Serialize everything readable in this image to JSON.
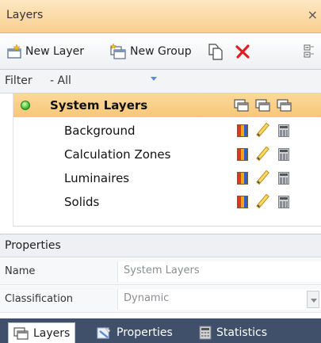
{
  "panel": {
    "title": "Layers",
    "close_glyph": "×"
  },
  "toolbar": {
    "new_layer_label": "New Layer",
    "new_group_label": "New Group",
    "icons": [
      "new-layer-icon",
      "new-group-icon",
      "copy-icon",
      "delete-icon",
      "expand-collapse-icon"
    ]
  },
  "filter": {
    "label": "Filter",
    "value": "- All"
  },
  "tree": {
    "group": {
      "label": "System Layers",
      "status": "active"
    },
    "items": [
      {
        "label": "Background"
      },
      {
        "label": "Calculation Zones"
      },
      {
        "label": "Luminaires"
      },
      {
        "label": "Solids"
      }
    ]
  },
  "properties": {
    "header": "Properties",
    "rows": [
      {
        "name": "Name",
        "value": "System Layers"
      },
      {
        "name": "Classification",
        "value": "Dynamic"
      }
    ]
  },
  "tabs": [
    {
      "label": "Layers",
      "active": true
    },
    {
      "label": "Properties",
      "active": false
    },
    {
      "label": "Statistics",
      "active": false
    }
  ],
  "colors": {
    "title_bar": "#f9cf8f",
    "selection": "#f7c778",
    "tab_strip": "#41506a",
    "delete_red": "#e02020",
    "status_green": "#3db82b"
  }
}
